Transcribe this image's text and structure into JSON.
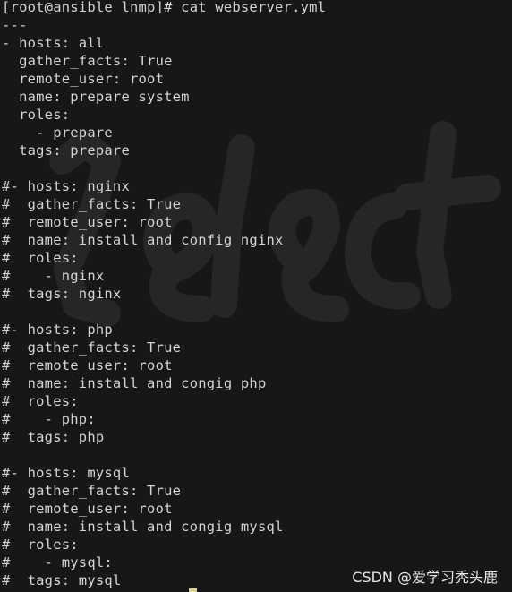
{
  "terminal": {
    "prompt_line": "[root@ansible lnmp]# cat webserver.yml",
    "lines": [
      "---",
      "- hosts: all",
      "  gather_facts: True",
      "  remote_user: root",
      "  name: prepare system",
      "  roles:",
      "    - prepare",
      "  tags: prepare",
      "",
      "#- hosts: nginx",
      "#  gather_facts: True",
      "#  remote_user: root",
      "#  name: install and config nginx",
      "#  roles:",
      "#    - nginx",
      "#  tags: nginx",
      "",
      "#- hosts: php",
      "#  gather_facts: True",
      "#  remote_user: root",
      "#  name: install and congig php",
      "#  roles:",
      "#    - php:",
      "#  tags: php",
      "",
      "#- hosts: mysql",
      "#  gather_facts: True",
      "#  remote_user: root",
      "#  name: install and congig mysql",
      "#  roles:",
      "#    - mysql:",
      "#  tags: mysql"
    ]
  },
  "watermark": {
    "csdn_text": "CSDN @爱学习秃头鹿"
  },
  "colors": {
    "background": "#171717",
    "text": "#d4d4d4",
    "cursor": "#d7d28a"
  }
}
